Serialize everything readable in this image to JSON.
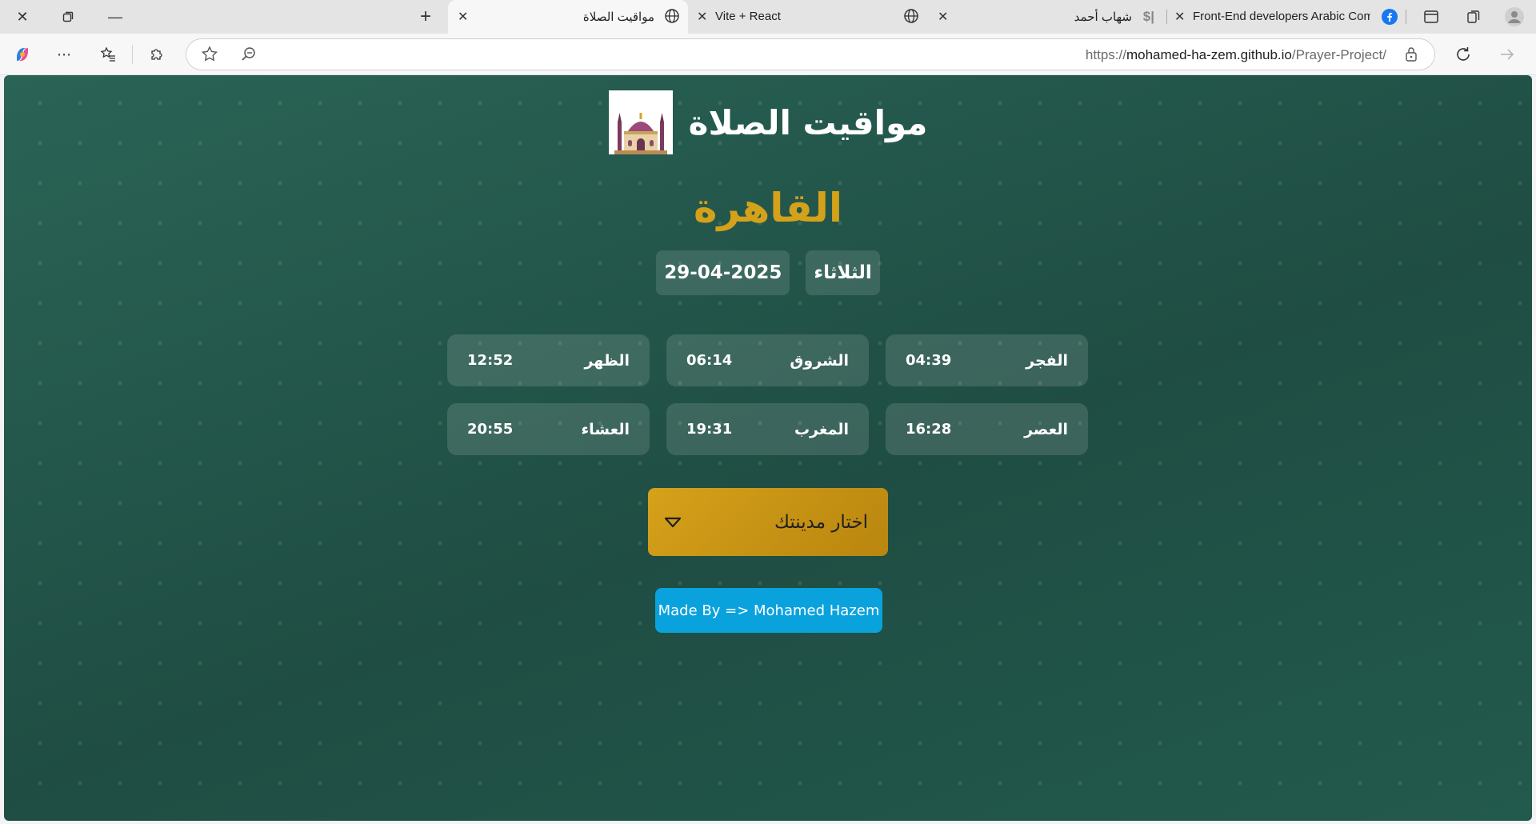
{
  "browser": {
    "tabs": [
      {
        "title": "مواقيت الصلاة",
        "active": true
      },
      {
        "title": "Vite + React",
        "active": false
      },
      {
        "title": "شهاب أحمد",
        "active": false
      },
      {
        "title": "Front-End developers Arabic Com",
        "active": false
      }
    ],
    "url_prefix": "https://",
    "url_host": "mohamed-ha-zem.github.io",
    "url_path": "/Prayer-Project/"
  },
  "page": {
    "app_title": "مواقيت الصلاة",
    "city": "القاهرة",
    "day": "الثلاثاء",
    "date": "29-04-2025",
    "prayers": [
      {
        "name": "الفجر",
        "time": "04:39"
      },
      {
        "name": "الشروق",
        "time": "06:14"
      },
      {
        "name": "الظهر",
        "time": "12:52"
      },
      {
        "name": "العصر",
        "time": "16:28"
      },
      {
        "name": "المغرب",
        "time": "19:31"
      },
      {
        "name": "العشاء",
        "time": "20:55"
      }
    ],
    "city_select_label": "اختار مدينتك",
    "credit": "Made By => Mohamed Hazem"
  },
  "colors": {
    "background": "#23554a",
    "accent_gold": "#d4a11a",
    "credit_blue": "#0aa2dd"
  },
  "icons": [
    "close-icon",
    "restore-icon",
    "minimize-icon",
    "new-tab-icon",
    "globe-icon",
    "facebook-icon",
    "sidebar-icon",
    "collections-icon",
    "profile-icon",
    "copilot-icon",
    "more-icon",
    "favorites-icon",
    "extensions-icon",
    "star-icon",
    "zoom-icon",
    "lock-icon",
    "refresh-icon",
    "forward-icon",
    "mosque-icon",
    "chevron-down-icon"
  ]
}
